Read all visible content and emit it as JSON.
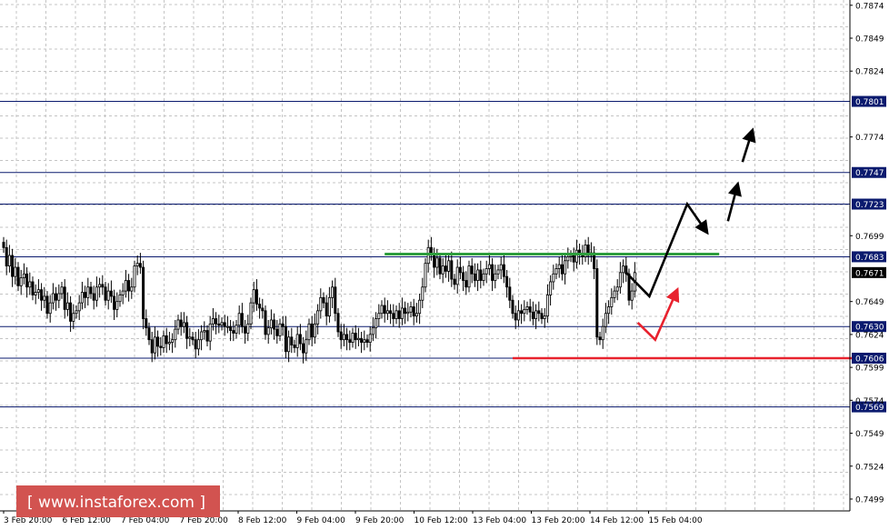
{
  "watermark": "[ www.instaforex.com ]",
  "chart_data": {
    "type": "candlestick",
    "instrument": "AUD/USD",
    "price_ticks": [
      "0.7874",
      "0.7849",
      "0.7824",
      "0.7801",
      "0.7774",
      "0.7747",
      "0.7723",
      "0.7699",
      "0.7683",
      "0.7649",
      "0.7630",
      "0.7624",
      "0.7606",
      "0.7599",
      "0.7574",
      "0.7569",
      "0.7549",
      "0.7524",
      "0.7499"
    ],
    "time_ticks": [
      "3 Feb 20:00",
      "6 Feb 12:00",
      "7 Feb 04:00",
      "7 Feb 20:00",
      "8 Feb 12:00",
      "9 Feb 04:00",
      "9 Feb 20:00",
      "10 Feb 12:00",
      "13 Feb 04:00",
      "13 Feb 20:00",
      "14 Feb 12:00",
      "15 Feb 04:00"
    ],
    "ylim": [
      0.749,
      0.7878
    ],
    "current_price": "0.7671",
    "levels": [
      {
        "price": 0.7801,
        "label": "0.7801"
      },
      {
        "price": 0.7747,
        "label": "0.7747"
      },
      {
        "price": 0.7723,
        "label": "0.7723"
      },
      {
        "price": 0.7683,
        "label": "0.7683"
      },
      {
        "price": 0.763,
        "label": "0.7630"
      },
      {
        "price": 0.7606,
        "label": "0.7606"
      },
      {
        "price": 0.7569,
        "label": "0.7569"
      }
    ],
    "resistance_line": {
      "price": 0.7685,
      "color": "#2e9e3e",
      "x_from_bar": 131,
      "x_to_bar": 246
    },
    "support_line": {
      "price": 0.7606,
      "color": "#e8222e",
      "x_from_bar": 175,
      "x_to_bar": 302
    },
    "close_series": [
      0.769,
      0.7676,
      0.7684,
      0.7668,
      0.7675,
      0.7661,
      0.7667,
      0.767,
      0.766,
      0.7664,
      0.7654,
      0.7656,
      0.7658,
      0.765,
      0.7653,
      0.764,
      0.7648,
      0.7655,
      0.765,
      0.7655,
      0.766,
      0.7643,
      0.7648,
      0.7634,
      0.764,
      0.7642,
      0.7648,
      0.7656,
      0.7652,
      0.766,
      0.7655,
      0.765,
      0.766,
      0.7662,
      0.766,
      0.765,
      0.7657,
      0.7653,
      0.7643,
      0.7649,
      0.7654,
      0.7657,
      0.7665,
      0.7657,
      0.766,
      0.7676,
      0.7678,
      0.7675,
      0.7636,
      0.7629,
      0.762,
      0.761,
      0.7622,
      0.7615,
      0.7614,
      0.7623,
      0.7617,
      0.7618,
      0.762,
      0.7628,
      0.7635,
      0.763,
      0.7633,
      0.7621,
      0.7622,
      0.762,
      0.7613,
      0.762,
      0.7626,
      0.7627,
      0.7619,
      0.7632,
      0.7636,
      0.7632,
      0.7631,
      0.7633,
      0.763,
      0.763,
      0.7627,
      0.7625,
      0.7631,
      0.764,
      0.763,
      0.7625,
      0.7632,
      0.7648,
      0.7658,
      0.7647,
      0.7644,
      0.7642,
      0.7624,
      0.7629,
      0.7635,
      0.7628,
      0.7623,
      0.7632,
      0.763,
      0.7611,
      0.7622,
      0.7616,
      0.7614,
      0.7624,
      0.7617,
      0.761,
      0.762,
      0.7632,
      0.7622,
      0.7632,
      0.7642,
      0.7652,
      0.7648,
      0.7638,
      0.7652,
      0.766,
      0.764,
      0.7626,
      0.762,
      0.7624,
      0.762,
      0.7618,
      0.7625,
      0.762,
      0.7621,
      0.7618,
      0.762,
      0.7618,
      0.7624,
      0.7629,
      0.7636,
      0.764,
      0.7646,
      0.764,
      0.7642,
      0.764,
      0.7636,
      0.7642,
      0.7636,
      0.7644,
      0.764,
      0.7641,
      0.7645,
      0.7638,
      0.764,
      0.765,
      0.766,
      0.7678,
      0.769,
      0.7685,
      0.7675,
      0.7682,
      0.767,
      0.7676,
      0.7672,
      0.768,
      0.7666,
      0.7662,
      0.7675,
      0.7671,
      0.7665,
      0.766,
      0.7676,
      0.767,
      0.7665,
      0.7673,
      0.7665,
      0.767,
      0.7674,
      0.7677,
      0.7665,
      0.767,
      0.7673,
      0.7677,
      0.7668,
      0.766,
      0.765,
      0.764,
      0.7635,
      0.7642,
      0.764,
      0.7643,
      0.7645,
      0.7641,
      0.7636,
      0.7642,
      0.764,
      0.7636,
      0.7638,
      0.7654,
      0.7664,
      0.767,
      0.7674,
      0.7677,
      0.767,
      0.768,
      0.7683,
      0.7684,
      0.7679,
      0.7688,
      0.7685,
      0.7683,
      0.7692,
      0.7684,
      0.7686,
      0.7674,
      0.7622,
      0.762,
      0.763,
      0.764,
      0.7645,
      0.7652,
      0.7657,
      0.766,
      0.7671,
      0.7676,
      0.767,
      0.765,
      0.7657,
      0.7671
    ],
    "forecast_black": [
      [
        [
          214,
          0.7671
        ],
        [
          222,
          0.7653
        ],
        [
          235,
          0.7723
        ],
        [
          241,
          0.7704
        ]
      ],
      [
        [
          249,
          0.771
        ],
        [
          252,
          0.7735
        ]
      ],
      [
        [
          254,
          0.7755
        ],
        [
          257,
          0.7776
        ]
      ]
    ],
    "forecast_red": [
      [
        [
          218,
          0.7633
        ],
        [
          224,
          0.762
        ],
        [
          231,
          0.7655
        ]
      ]
    ]
  }
}
